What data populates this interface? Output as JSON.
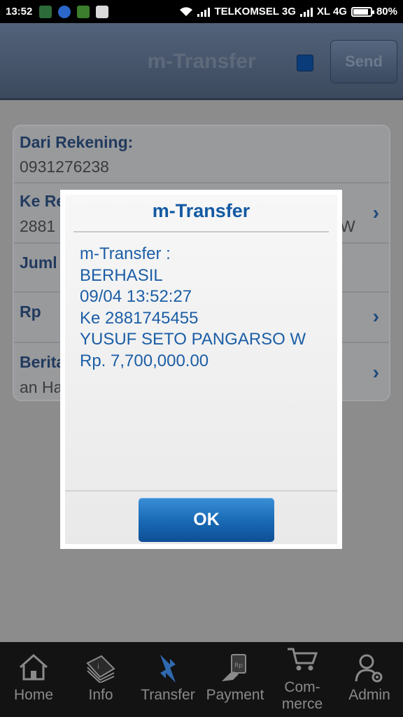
{
  "status_bar": {
    "time": "13:52",
    "carrier1": "TELKOMSEL 3G",
    "carrier2": "XL 4G",
    "battery": "80%"
  },
  "header": {
    "title": "m-Transfer",
    "send_label": "Send"
  },
  "form": {
    "from_label": "Dari Rekening:",
    "from_value": "0931276238",
    "to_label": "Ke Re",
    "to_value": "2881",
    "to_tail": "W",
    "amount_label": "Juml",
    "currency_label": "Rp",
    "message_label": "Berita",
    "message_value": "an Ha"
  },
  "dialog": {
    "title": "m-Transfer",
    "lines": [
      "m-Transfer :",
      "BERHASIL",
      "09/04 13:52:27",
      "Ke 2881745455",
      "YUSUF SETO PANGARSO W",
      "Rp. 7,700,000.00"
    ],
    "ok_label": "OK"
  },
  "nav": [
    {
      "label": "Home",
      "icon": "home-icon"
    },
    {
      "label": "Info",
      "icon": "info-icon"
    },
    {
      "label": "Transfer",
      "icon": "transfer-icon"
    },
    {
      "label": "Payment",
      "icon": "payment-icon"
    },
    {
      "label": "Com-\nmerce",
      "icon": "cart-icon"
    },
    {
      "label": "Admin",
      "icon": "admin-icon"
    }
  ],
  "colors": {
    "accent": "#125aa2",
    "ok_button": "#1868b4"
  }
}
